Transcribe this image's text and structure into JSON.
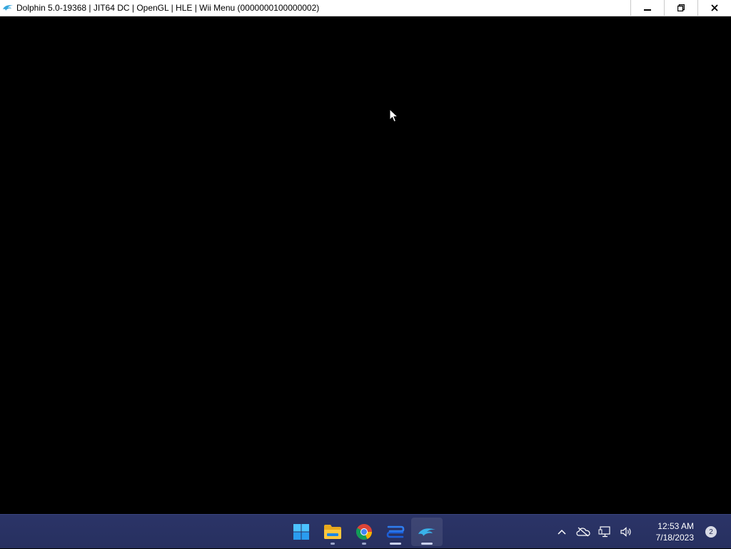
{
  "window": {
    "title": "Dolphin 5.0-19368 | JIT64 DC | OpenGL | HLE | Wii Menu (0000000100000002)",
    "app_icon": "dolphin-icon",
    "controls": [
      "minimize-icon",
      "restore-icon",
      "close-icon"
    ]
  },
  "taskbar": {
    "apps": [
      {
        "name": "start-button",
        "icon": "windows-logo-icon"
      },
      {
        "name": "file-explorer",
        "icon": "folder-icon"
      },
      {
        "name": "chrome",
        "icon": "chrome-icon"
      },
      {
        "name": "app-blue",
        "icon": "blue-app-icon"
      },
      {
        "name": "dolphin",
        "icon": "dolphin-icon",
        "active": true
      }
    ],
    "tray": {
      "icons": [
        "chevron-up-icon",
        "onedrive-offline-icon",
        "network-icon",
        "volume-icon"
      ],
      "time": "12:53 AM",
      "date": "7/18/2023",
      "notification_count": "2"
    }
  },
  "colors": {
    "taskbar": "#2b3467",
    "viewport": "#000000",
    "dolphin_blue": "#2aa7e0"
  }
}
